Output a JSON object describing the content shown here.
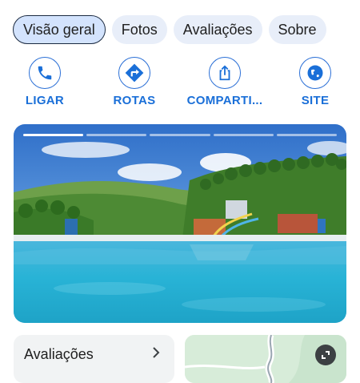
{
  "tabs": [
    {
      "label": "Visão geral",
      "active": true
    },
    {
      "label": "Fotos",
      "active": false
    },
    {
      "label": "Avaliações",
      "active": false
    },
    {
      "label": "Sobre",
      "active": false
    }
  ],
  "actions": [
    {
      "label": "LIGAR",
      "icon": "phone-icon"
    },
    {
      "label": "ROTAS",
      "icon": "directions-icon"
    },
    {
      "label": "COMPARTI...",
      "icon": "share-icon"
    },
    {
      "label": "SITE",
      "icon": "globe-icon"
    }
  ],
  "photo": {
    "segments_total": 5,
    "active_segment": 1
  },
  "reviews_card": {
    "title": "Avaliações",
    "icon": "chevron-right-icon"
  },
  "map_card": {
    "icon": "expand-icon"
  },
  "colors": {
    "accent": "#1a6fd8",
    "tab_bg": "#e8eef9",
    "tab_active_bg": "#d3e3fd",
    "pool": "#28b3d6"
  }
}
